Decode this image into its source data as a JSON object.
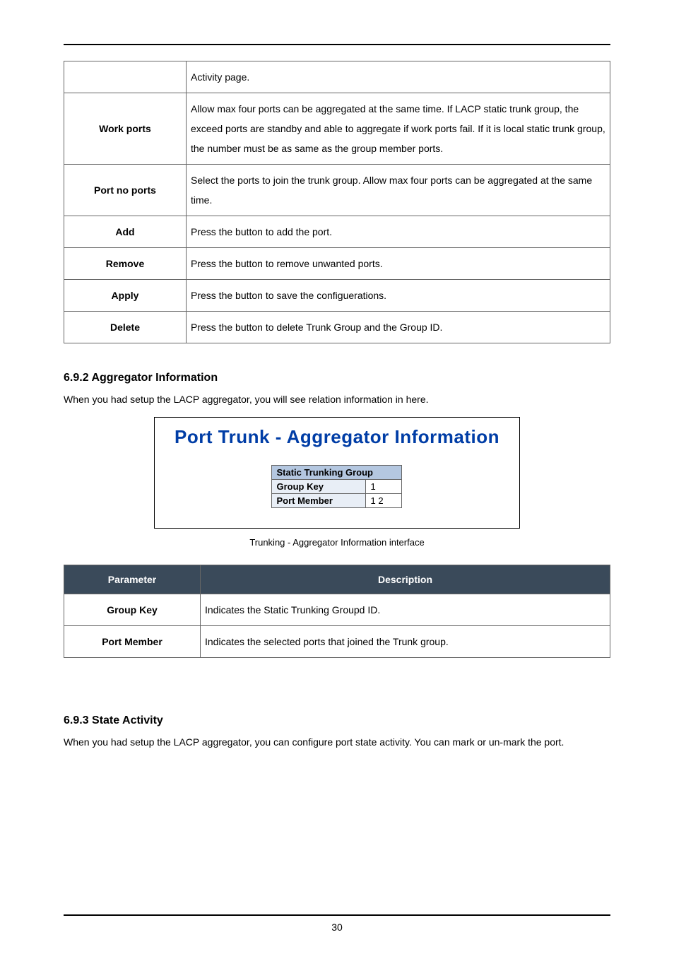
{
  "pageNumber": "30",
  "table1": {
    "rows": [
      {
        "label": "",
        "desc": "Activity page."
      },
      {
        "label": "Work ports",
        "desc": "Allow max four ports can be aggregated at the same time. If LACP static trunk group, the exceed ports are standby and able to aggregate if work ports fail. If it is local static trunk group, the number must be as same as the group member ports."
      },
      {
        "label": "Port no ports",
        "desc": "Select the ports to join the trunk group. Allow max four ports can be aggregated at the same time."
      },
      {
        "label": "Add",
        "desc": "Press the button to add the port."
      },
      {
        "label": "Remove",
        "desc": "Press the button to remove unwanted ports."
      },
      {
        "label": "Apply",
        "desc": "Press the button to save the configuerations."
      },
      {
        "label": "Delete",
        "desc": "Press the button to delete Trunk Group and the Group ID."
      }
    ]
  },
  "section1": {
    "title": "6.9.2 Aggregator Information",
    "intro": "When you had setup the LACP aggregator, you will see relation information in here."
  },
  "figure": {
    "heading": "Port Trunk - Aggregator Information",
    "subhead": "Static Trunking Group",
    "groupKeyLabel": "Group Key",
    "groupKeyValue": "1",
    "portMemberLabel": "Port Member",
    "portMemberValue": "1 2",
    "caption": "Trunking - Aggregator Information interface"
  },
  "table2": {
    "head": {
      "param": "Parameter",
      "desc": "Description"
    },
    "rows": [
      {
        "label": "Group Key",
        "desc": "Indicates the Static Trunking Groupd ID."
      },
      {
        "label": "Port Member",
        "desc": "Indicates the selected ports that joined the Trunk group."
      }
    ]
  },
  "section2": {
    "title": "6.9.3 State Activity",
    "intro": "When you had setup the LACP aggregator, you can configure port state activity. You can mark or un-mark the port."
  }
}
